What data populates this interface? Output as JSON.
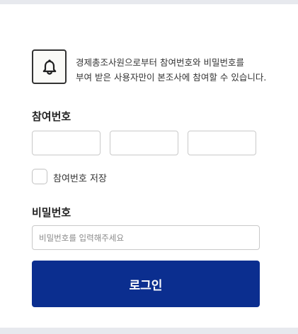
{
  "notice": {
    "icon": "bell-icon",
    "line1": "경제총조사원으로부터 참여번호와 비밀번호를",
    "line2": "부여 받은 사용자만이 본조사에 참여할 수 있습니다."
  },
  "participation": {
    "label": "참여번호",
    "fields": [
      {
        "value": ""
      },
      {
        "value": ""
      },
      {
        "value": ""
      }
    ],
    "save_checkbox_label": "참여번호 저장",
    "save_checked": false
  },
  "password": {
    "label": "비밀번호",
    "placeholder": "비밀번호를 입력해주세요",
    "value": ""
  },
  "login_button": {
    "label": "로그인",
    "color": "#0b2e8f"
  }
}
